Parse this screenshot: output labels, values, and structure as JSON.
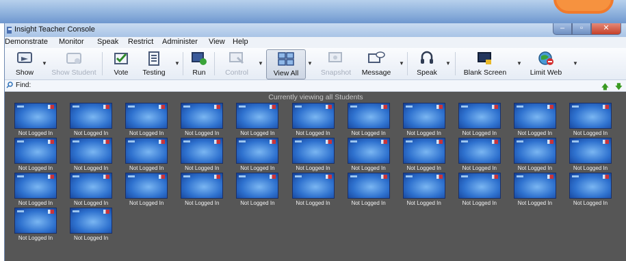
{
  "window": {
    "title": "Insight Teacher Console"
  },
  "menu": [
    "Demonstrate",
    "Monitor",
    "Speak",
    "Restrict",
    "Administer",
    "View",
    "Help"
  ],
  "toolbar": {
    "show": "Show",
    "show_student": "Show Student",
    "vote": "Vote",
    "testing": "Testing",
    "run": "Run",
    "control": "Control",
    "view_all": "View All",
    "snapshot": "Snapshot",
    "message": "Message",
    "speak": "Speak",
    "blank_screen": "Blank Screen",
    "limit_web": "Limit Web"
  },
  "find": {
    "label": "Find:",
    "value": ""
  },
  "viewer": {
    "heading": "Currently viewing all Students",
    "students": [
      {
        "status": "Not Logged In"
      },
      {
        "status": "Not Logged In"
      },
      {
        "status": "Not Logged In"
      },
      {
        "status": "Not Logged In"
      },
      {
        "status": "Not Logged In"
      },
      {
        "status": "Not Logged In"
      },
      {
        "status": "Not Logged In"
      },
      {
        "status": "Not Logged In"
      },
      {
        "status": "Not Logged In"
      },
      {
        "status": "Not Logged In"
      },
      {
        "status": "Not Logged In"
      },
      {
        "status": "Not Logged In"
      },
      {
        "status": "Not Logged In"
      },
      {
        "status": "Not Logged In"
      },
      {
        "status": "Not Logged In"
      },
      {
        "status": "Not Logged In"
      },
      {
        "status": "Not Logged In"
      },
      {
        "status": "Not Logged In"
      },
      {
        "status": "Not Logged In"
      },
      {
        "status": "Not Logged In"
      },
      {
        "status": "Not Logged In"
      },
      {
        "status": "Not Logged In"
      },
      {
        "status": "Not Logged In"
      },
      {
        "status": "Not Logged In"
      },
      {
        "status": "Not Logged In"
      },
      {
        "status": "Not Logged In"
      },
      {
        "status": "Not Logged In"
      },
      {
        "status": "Not Logged In"
      },
      {
        "status": "Not Logged In"
      },
      {
        "status": "Not Logged In"
      },
      {
        "status": "Not Logged In"
      },
      {
        "status": "Not Logged In"
      },
      {
        "status": "Not Logged In"
      },
      {
        "status": "Not Logged In"
      },
      {
        "status": "Not Logged In"
      }
    ]
  },
  "colors": {
    "accent": "#f6923f",
    "viewer_bg": "#565656",
    "screen_blue": "#2f72cf"
  }
}
